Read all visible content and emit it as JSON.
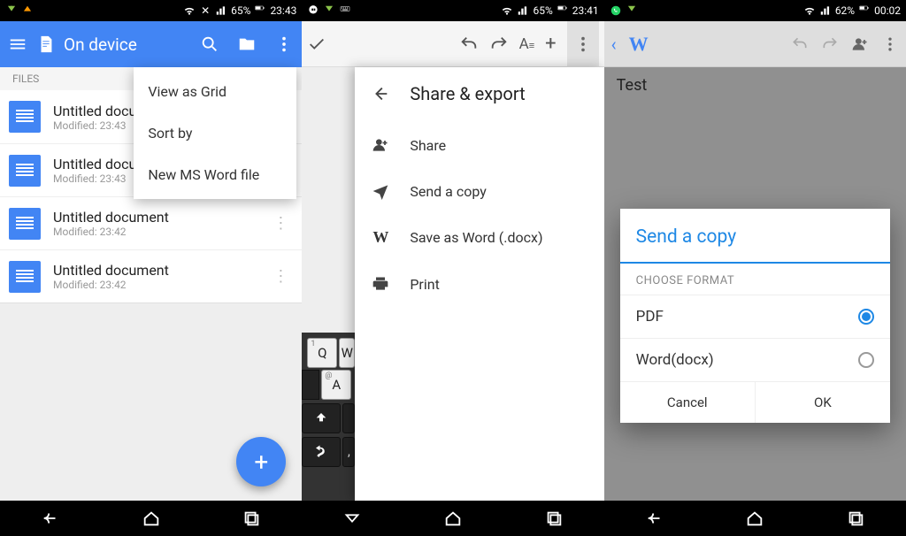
{
  "screen1": {
    "statusbar": {
      "battery_text": "65%",
      "time": "23:43"
    },
    "appbar": {
      "title": "On device"
    },
    "section_label": "FILES",
    "files": [
      {
        "title": "Untitled document",
        "sub": "Modified: 23:43"
      },
      {
        "title": "Untitled document",
        "sub": "Modified: 23:43"
      },
      {
        "title": "Untitled document",
        "sub": "Modified: 23:42"
      },
      {
        "title": "Untitled document",
        "sub": "Modified: 23:42"
      }
    ],
    "menu": {
      "items": [
        "View as Grid",
        "Sort by",
        "New MS Word file"
      ]
    }
  },
  "screen2": {
    "statusbar": {
      "battery_text": "65%",
      "time": "23:41"
    },
    "panel": {
      "title": "Share & export",
      "items": [
        "Share",
        "Send a copy",
        "Save as Word (.docx)",
        "Print"
      ]
    },
    "keys": [
      "Q",
      "W",
      "A"
    ]
  },
  "screen3": {
    "statusbar": {
      "battery_text": "62%",
      "time": "00:02"
    },
    "brand": "W",
    "doc_text": "Test",
    "dialog": {
      "title": "Send a copy",
      "subtitle": "CHOOSE FORMAT",
      "options": [
        "PDF",
        "Word(docx)"
      ],
      "selected": 0,
      "buttons": {
        "cancel": "Cancel",
        "ok": "OK"
      }
    }
  }
}
